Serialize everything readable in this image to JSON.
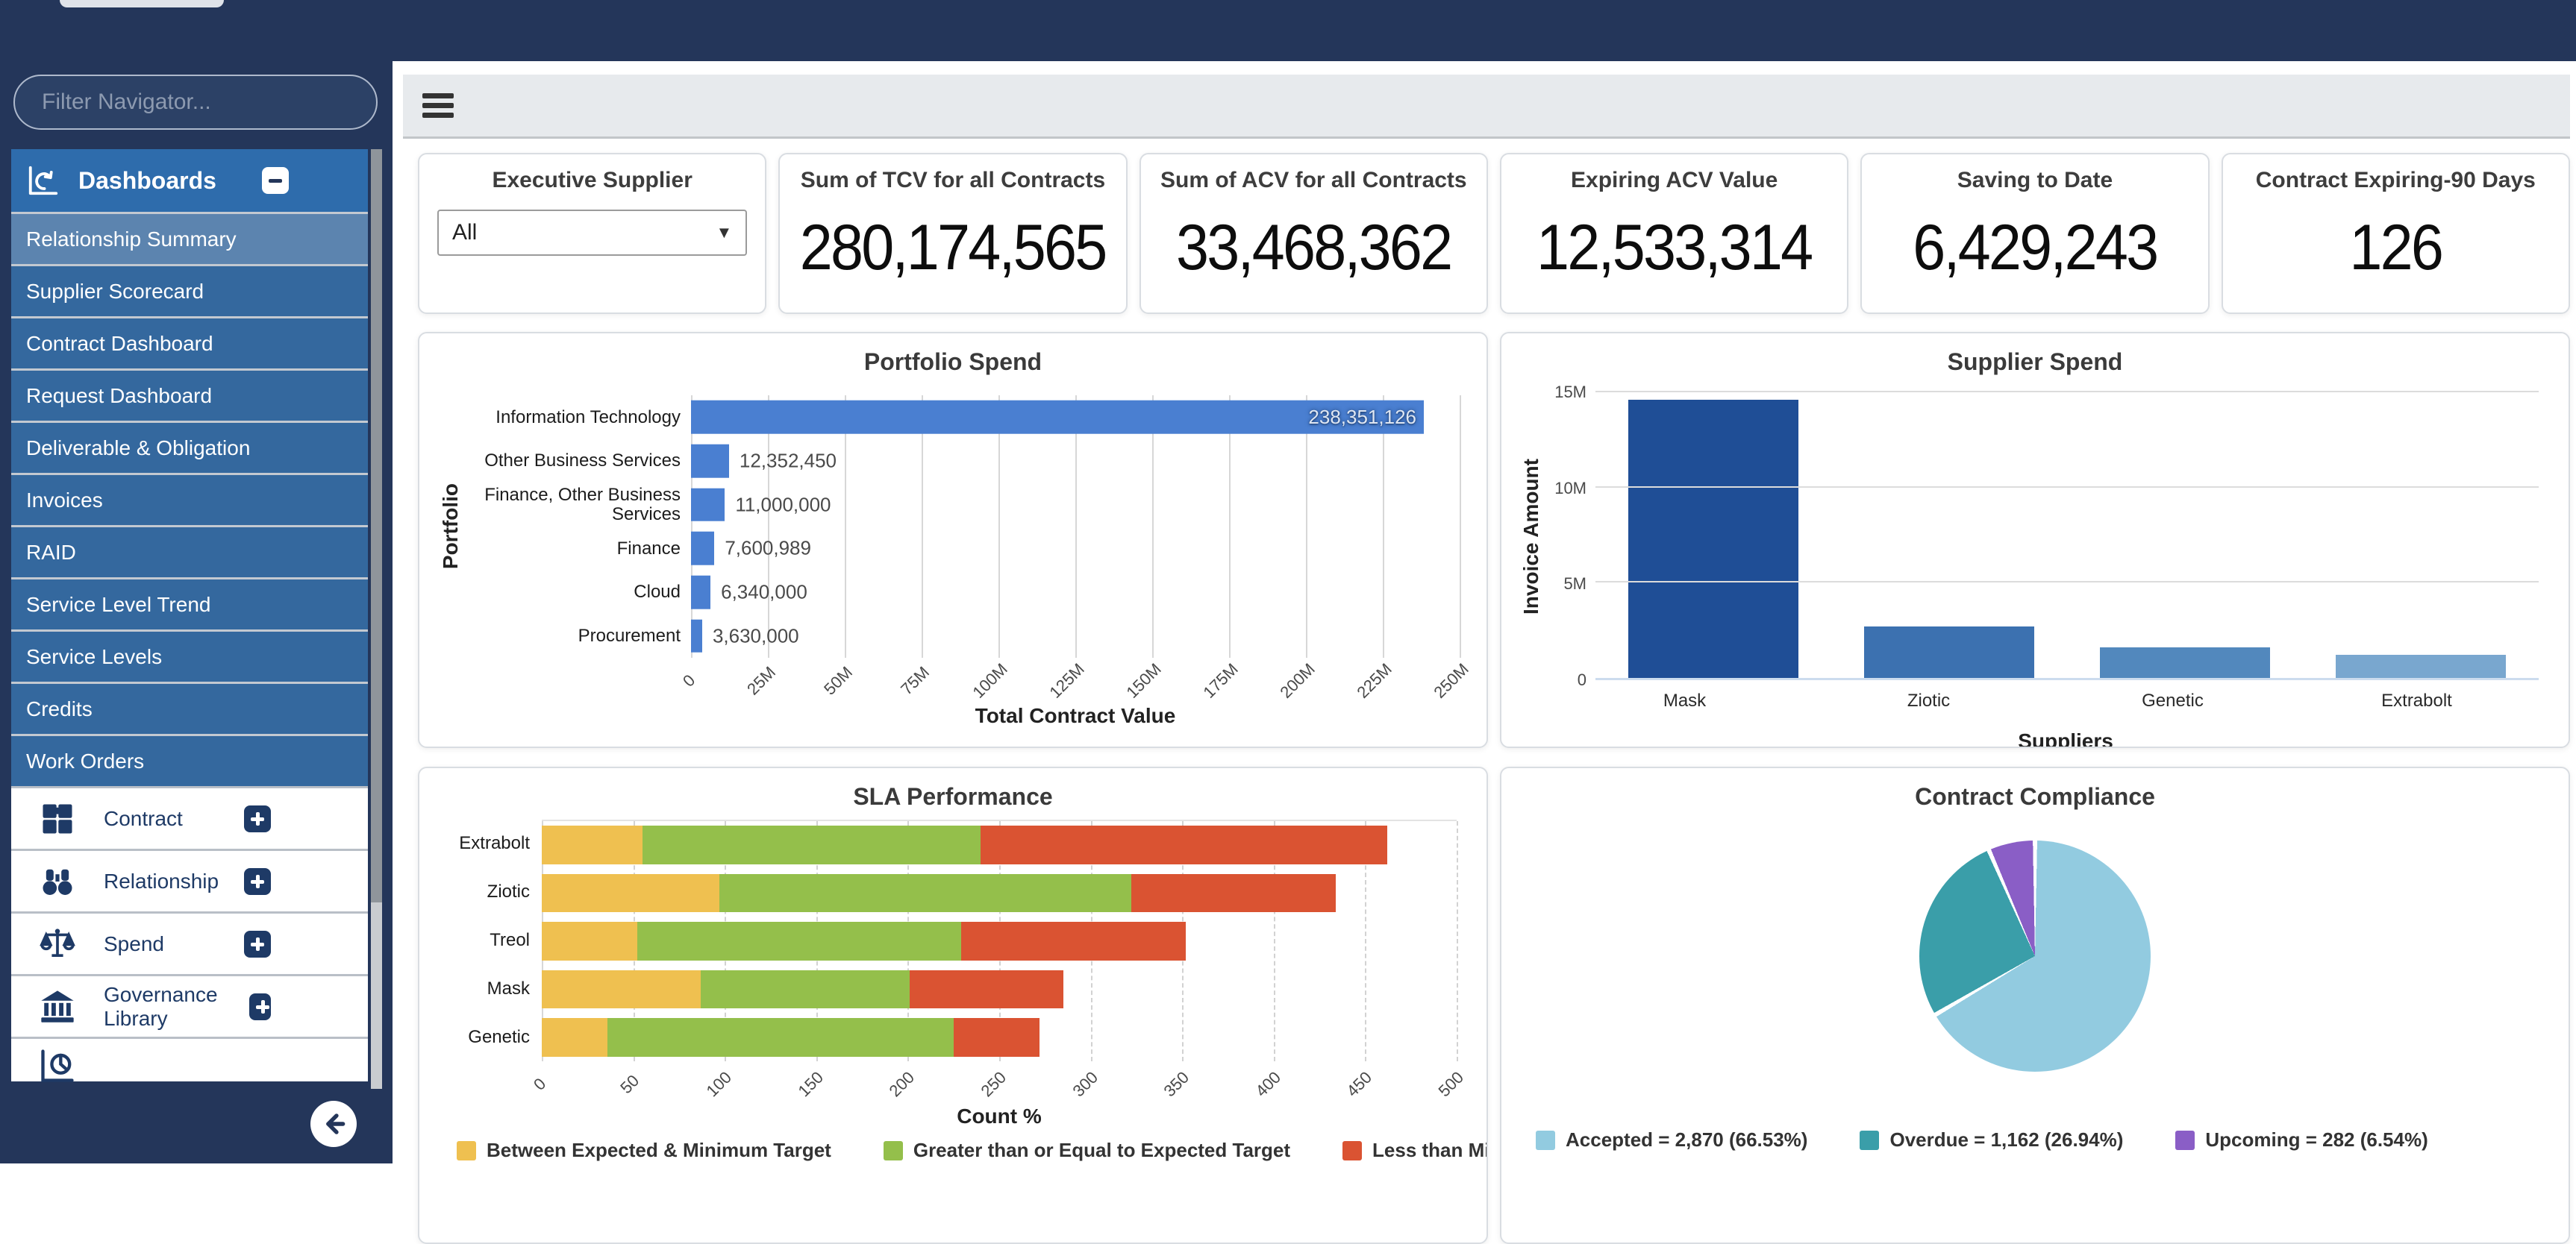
{
  "colors": {
    "topbar_navy": "#24365a",
    "menu_header_blue": "#2e6cac",
    "menu_item_blue": "#34689e",
    "menu_item_selected": "#5c84af",
    "portfolio_bar_blue": "#4a7fd1",
    "supplier_bar_colors": [
      "#1f4e96",
      "#3c71b0",
      "#5288bd",
      "#79a7cf"
    ],
    "sla_colors": [
      "#efc050",
      "#94bf4b",
      "#da5332"
    ],
    "pie_colors": [
      "#92cbe0",
      "#3a9ea9",
      "#8a5ec6"
    ]
  },
  "sidebar": {
    "filter_placeholder": "Filter Navigator...",
    "dashboards": {
      "label": "Dashboards",
      "selected_item": "Relationship Summary",
      "items": [
        "Relationship Summary",
        "Supplier Scorecard",
        "Contract Dashboard",
        "Request Dashboard",
        "Deliverable & Obligation",
        "Invoices",
        "RAID",
        "Service Level Trend",
        "Service Levels",
        "Credits",
        "Work Orders"
      ]
    },
    "modules": [
      {
        "label": "Contract",
        "icon": "puzzle-icon"
      },
      {
        "label": "Relationship",
        "icon": "binoculars-icon"
      },
      {
        "label": "Spend",
        "icon": "scales-icon"
      },
      {
        "label": "Governance Library",
        "icon": "bank-icon"
      }
    ],
    "partial_module_icon": "chart-icon"
  },
  "filter_card": {
    "title": "Executive Supplier",
    "selected_value": "All"
  },
  "kpis": [
    {
      "title": "Sum of TCV for all Contracts",
      "value": "280,174,565"
    },
    {
      "title": "Sum of ACV for all Contracts",
      "value": "33,468,362"
    },
    {
      "title": "Expiring ACV Value",
      "value": "12,533,314"
    },
    {
      "title": "Saving to Date",
      "value": "6,429,243"
    },
    {
      "title": "Contract Expiring-90 Days",
      "value": "126"
    }
  ],
  "chart_data": [
    {
      "type": "bar",
      "orientation": "horizontal",
      "title": "Portfolio Spend",
      "xlabel": "Total Contract Value",
      "ylabel": "Portfolio",
      "categories": [
        "Information Technology",
        "Other Business Services",
        "Finance, Other Business Services",
        "Finance",
        "Cloud",
        "Procurement"
      ],
      "values": [
        238351126,
        12352450,
        11000000,
        7600989,
        6340000,
        3630000
      ],
      "value_labels": [
        "238,351,126",
        "12,352,450",
        "11,000,000",
        "7,600,989",
        "6,340,000",
        "3,630,000"
      ],
      "xlim": [
        0,
        250000000
      ],
      "x_ticks": [
        "0",
        "25M",
        "50M",
        "75M",
        "100M",
        "125M",
        "150M",
        "175M",
        "200M",
        "225M",
        "250M"
      ],
      "grid": true
    },
    {
      "type": "bar",
      "orientation": "vertical",
      "title": "Supplier Spend",
      "xlabel": "Suppliers",
      "ylabel": "Invoice Amount",
      "categories": [
        "Mask",
        "Ziotic",
        "Genetic",
        "Extrabolt"
      ],
      "values": [
        14600000,
        2700000,
        1600000,
        1200000
      ],
      "ylim": [
        0,
        15000000
      ],
      "y_ticks": [
        "0",
        "5M",
        "10M",
        "15M"
      ],
      "grid": true
    },
    {
      "type": "bar",
      "orientation": "horizontal",
      "stacked": true,
      "title": "SLA Performance",
      "xlabel": "Count %",
      "categories": [
        "Extrabolt",
        "Ziotic",
        "Treol",
        "Mask",
        "Genetic"
      ],
      "series": [
        {
          "name": "Between Expected & Minimum Target",
          "color": "#efc050",
          "values": [
            55,
            97,
            52,
            87,
            36
          ]
        },
        {
          "name": "Greater than or Equal to Expected Target",
          "color": "#94bf4b",
          "values": [
            185,
            225,
            177,
            114,
            189
          ]
        },
        {
          "name": "Less than Minimum Target",
          "color": "#da5332",
          "values": [
            222,
            112,
            123,
            84,
            47
          ]
        }
      ],
      "xlim": [
        0,
        500
      ],
      "x_ticks": [
        "0",
        "50",
        "100",
        "150",
        "200",
        "250",
        "300",
        "350",
        "400",
        "450",
        "500"
      ],
      "legend_position": "bottom",
      "grid": true
    },
    {
      "type": "pie",
      "title": "Contract Compliance",
      "slices": [
        {
          "name": "Accepted",
          "value": 2870,
          "pct": 66.53,
          "color": "#92cbe0",
          "label": "Accepted = 2,870 (66.53%)"
        },
        {
          "name": "Overdue",
          "value": 1162,
          "pct": 26.94,
          "color": "#3a9ea9",
          "label": "Overdue = 1,162 (26.94%)"
        },
        {
          "name": "Upcoming",
          "value": 282,
          "pct": 6.54,
          "color": "#8a5ec6",
          "label": "Upcoming = 282 (6.54%)"
        }
      ],
      "legend_position": "bottom"
    }
  ]
}
